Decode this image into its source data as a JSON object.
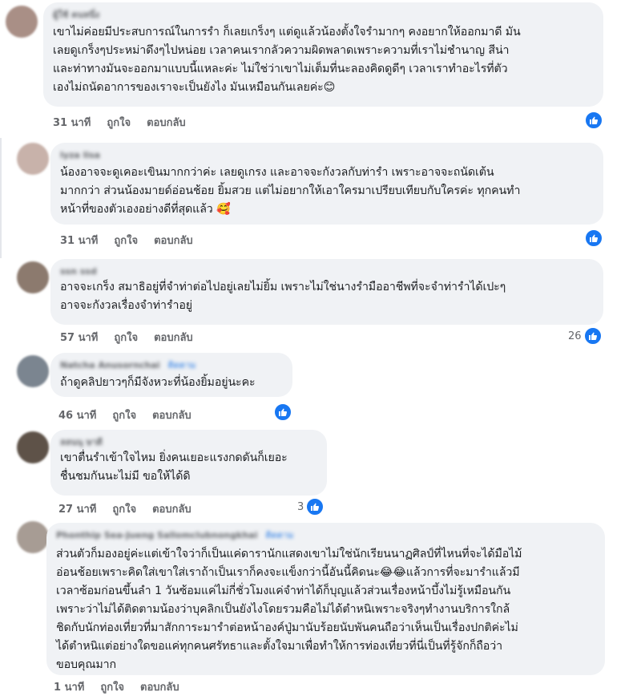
{
  "comments": [
    {
      "author": "ผู้ใช้ คนหนึ่ง",
      "role": "",
      "text": "เขาไม่ค่อยมีประสบการณ์ในการรำ ก็เลยเกร็งๆ แต่ดูแล้วน้องตั้งใจรำมากๆ คงอยากให้ออกมาดี มัน\nเลยดูเกร็งๆประหม่าดึงๆไปหน่อย เวลาคนเรากลัวความผิดพลาดเพราะความที่เราไม่ชำนาญ สีน่า\nและท่าทางมันจะออกมาแบบนี้แหละค่ะ ไม่ใช่ว่าเขาไม่เต็มที่นะลองคิดดูดีๆ เวลาเราทำอะไรที่ตัว\nเองไม่ถนัดอาการของเราจะเป็นยังไง มันเหมือนกันเลยค่ะ😊",
      "time": "31 นาที",
      "like": "ถูกใจ",
      "reply": "ตอบกลับ",
      "reactions": ""
    },
    {
      "author": "lyza lisa",
      "role": "",
      "text": "น้องอาจจะดูเคอะเขินมากกว่าค่ะ เลยดูเกรง และอาจจะกังวลกับท่ารำ เพราะอาจจะถนัดเต้น\nมากกว่า ส่วนน้องมายด์อ่อนช้อย ยิ้มสวย แต่ไม่อยากให้เอาใครมาเปรียบเทียบกับใครค่ะ ทุกคนทำ\nหน้าที่ของตัวเองอย่างดีที่สุดแล้ว 🥰",
      "time": "31 นาที",
      "like": "ถูกใจ",
      "reply": "ตอบกลับ",
      "reactions": ""
    },
    {
      "author": "ssn ssd",
      "role": "",
      "text": "อาจจะเกร็ง สมาธิอยู่ที่จำท่าต่อไปอยู่เลยไม่ยิ้ม เพราะไม่ใช่นางรำมืออาชีพที่จะจำท่ารำได้เปะๆ\nอาจจะกังวลเรื่องจำท่ารำอยู่",
      "time": "57 นาที",
      "like": "ถูกใจ",
      "reply": "ตอบกลับ",
      "reactions": "26"
    },
    {
      "author": "Natcha Anusornchai",
      "role": "ติดตาม",
      "text": "ถ้าดูคลิปยาวๆก็มีจังหวะที่น้องยิ้มอยู่นะคะ",
      "time": "46 นาที",
      "like": "ถูกใจ",
      "reply": "ตอบกลับ",
      "reactions": ""
    },
    {
      "author": "ลลนนุ ษาดี",
      "role": "",
      "text": "เขาตื่นรำเข้าใจไหม ยิ่งคนเยอะแรงกดดันก็เยอะ\nชื่นชมกันนะไม่มี ขอให้ได้ดิ",
      "time": "27 นาที",
      "like": "ถูกใจ",
      "reply": "ตอบกลับ",
      "reactions": "3"
    },
    {
      "author": "Phonthip Sea-Jueng Sallomclubnongkhai",
      "role": "ติดตาม",
      "text": "ส่วนตัวก็มองอยู่ค่ะแต่เข้าใจว่าก็เป็นแค่ดารานักแสดงเขาไม่ใช่นักเรียนนาฏศิลป์ที่ไหนที่จะได้มือไม้\nอ่อนช้อยเพราะคิดใส่เขาใส่เราถ้าเป็นเราก็คงจะแข็งกว่านี้อันนี้คิดนะ😂😂แล้วการที่จะมารำแล้วมี\nเวลาซ้อมก่อนขึ้นลำ 1 วันซ้อมแค่ไม่กี่ชั่วโมงแค่จำท่าได้ก็บุญแล้วส่วนเรื่องหน้าบึ้งไม่รู้เหมือนกัน\nเพราะว่าไม่ได้ติดตามน้องว่าบุคลิกเป็นยังไงโดยรวมคือไม่ได้ตำหนิเพราะจริงๆทำงานบริการใกล้\nชิดกับนักท่องเที่ยวที่มาสักการะมารำต่อหน้าองค์ปู่มานับร้อยนับพันคนถือว่าเห็นเป็นเรื่องปกติค่ะไม่\nได้ตำหนิแต่อย่างใดขอแค่ทุกคนศรัทธาและตั้งใจมาเพื่อทำให้การท่องเที่ยวที่นี่เป็นที่รู้จักก็ถือว่า\nขอบคุณมาก",
      "time": "1 นาที",
      "like": "ถูกใจ",
      "reply": "ตอบกลับ",
      "reactions": ""
    }
  ],
  "colors": {
    "bubble": "#f0f2f5",
    "meta": "#65676b",
    "like_badge": "#1877f2"
  },
  "icons": {
    "reaction": "thumbs-up-icon"
  }
}
